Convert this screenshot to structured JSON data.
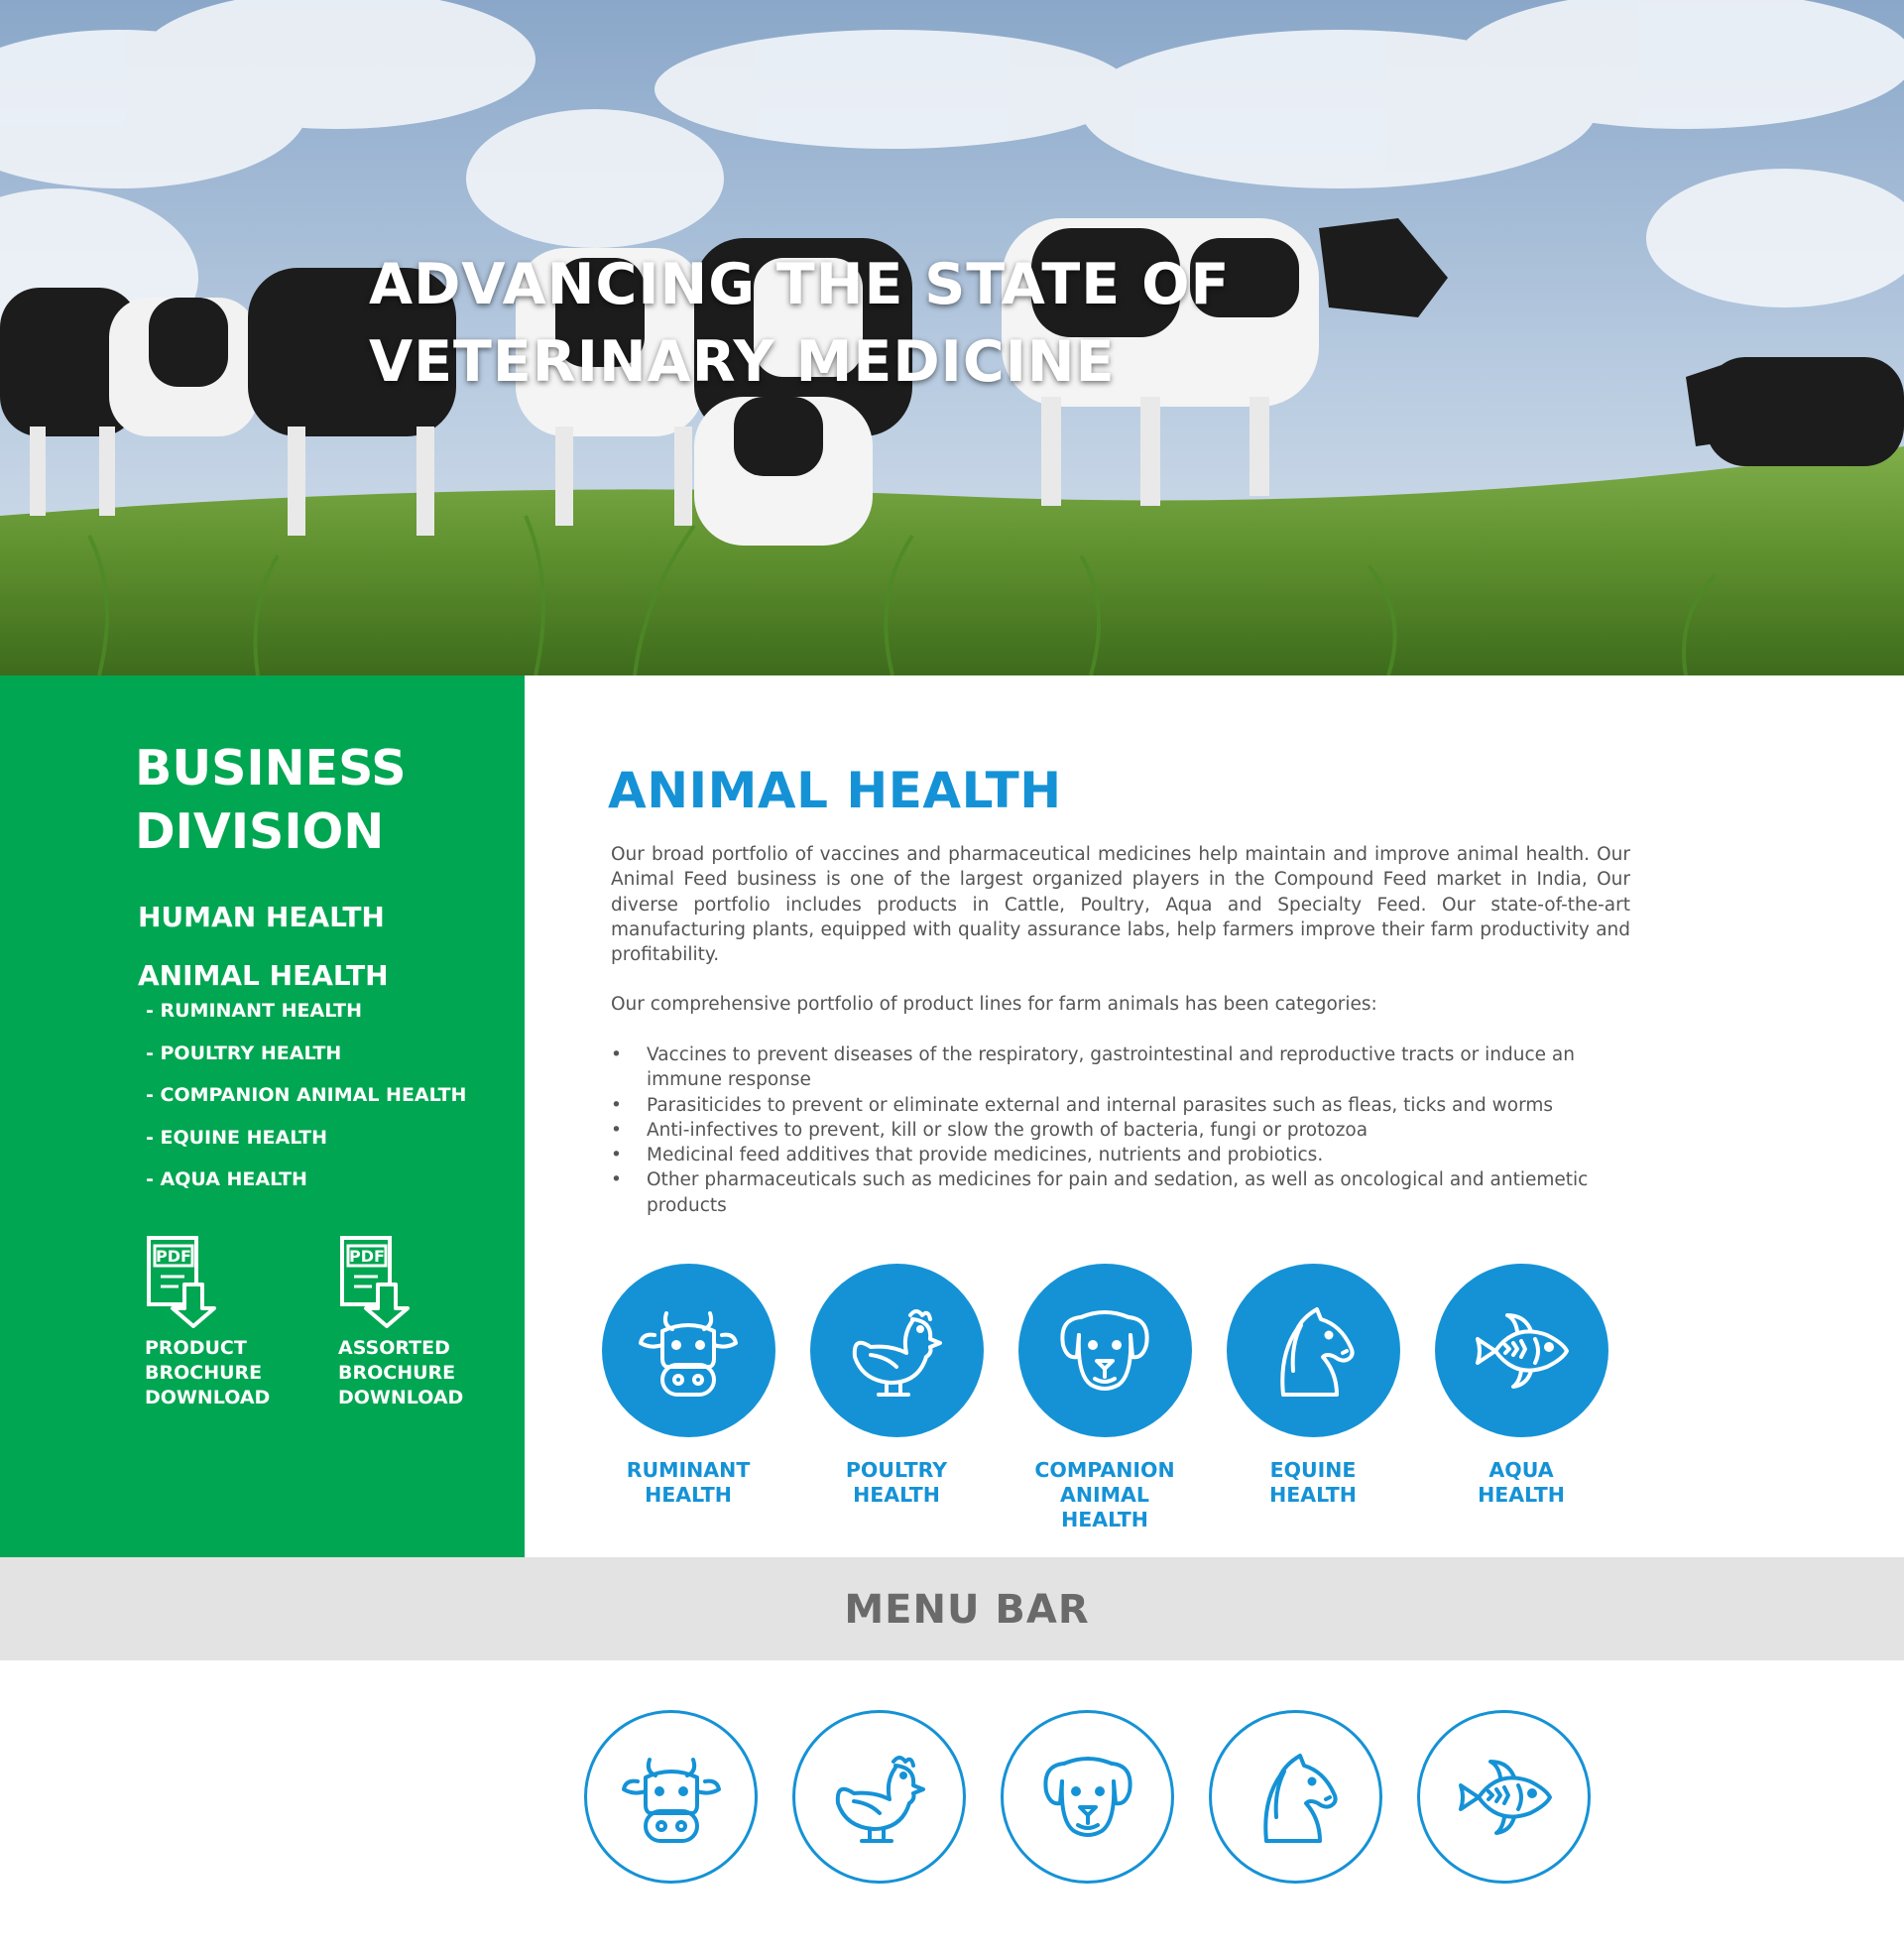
{
  "hero": {
    "title_line1": "ADVANCING THE STATE OF",
    "title_line2": "VETERINARY MEDICINE"
  },
  "sidebar": {
    "title_line1": "BUSINESS",
    "title_line2": "DIVISION",
    "nav": [
      {
        "label": "HUMAN HEALTH"
      },
      {
        "label": "ANIMAL HEALTH"
      }
    ],
    "sub_nav": [
      {
        "label": "- RUMINANT HEALTH"
      },
      {
        "label": "- POULTRY HEALTH"
      },
      {
        "label": "- COMPANION ANIMAL HEALTH"
      },
      {
        "label": "- EQUINE HEALTH"
      },
      {
        "label": "- AQUA HEALTH"
      }
    ],
    "downloads": [
      {
        "icon": "pdf-download-icon",
        "badge": "PDF",
        "line1": "PRODUCT",
        "line2": "BROCHURE",
        "line3": "DOWNLOAD"
      },
      {
        "icon": "pdf-download-icon",
        "badge": "PDF",
        "line1": "ASSORTED",
        "line2": "BROCHURE",
        "line3": "DOWNLOAD"
      }
    ],
    "color": "#00a651"
  },
  "main": {
    "title": "ANIMAL HEALTH",
    "paragraph1": "Our broad portfolio of vaccines and pharmaceutical medicines help maintain and improve animal health. Our Animal Feed business is one of the largest organized players in the Compound Feed market in India, Our diverse portfolio includes products in Cattle, Poultry, Aqua and Specialty Feed. Our state-of-the-art manufacturing plants, equipped with quality assurance labs, help farmers improve their farm productivity and profitability.",
    "paragraph2": "Our comprehensive portfolio of product lines for farm animals has been categories:",
    "bullets": [
      "Vaccines to prevent diseases of the respiratory, gastrointestinal and reproductive tracts or induce an immune response",
      "Parasiticides to prevent or eliminate external and internal parasites such as fleas, ticks and worms",
      "Anti-infectives to prevent, kill or slow the growth of bacteria, fungi or protozoa",
      "Medicinal feed additives that provide medicines, nutrients and probiotics.",
      "Other pharmaceuticals such as medicines for pain and sedation, as well as oncological and antiemetic products"
    ],
    "categories": [
      {
        "icon": "cow-icon",
        "line1": "RUMINANT",
        "line2": "HEALTH"
      },
      {
        "icon": "chicken-icon",
        "line1": "POULTRY",
        "line2": "HEALTH"
      },
      {
        "icon": "dog-icon",
        "line1": "COMPANION ANIMAL",
        "line2": "HEALTH"
      },
      {
        "icon": "horse-icon",
        "line1": "EQUINE",
        "line2": "HEALTH"
      },
      {
        "icon": "fish-icon",
        "line1": "AQUA",
        "line2": "HEALTH"
      }
    ],
    "accent_color": "#1592d6"
  },
  "menubar": {
    "label": "MENU BAR",
    "color": "#e3e3e3"
  },
  "outline_icons": [
    "cow-icon",
    "chicken-icon",
    "dog-icon",
    "horse-icon",
    "fish-icon"
  ]
}
